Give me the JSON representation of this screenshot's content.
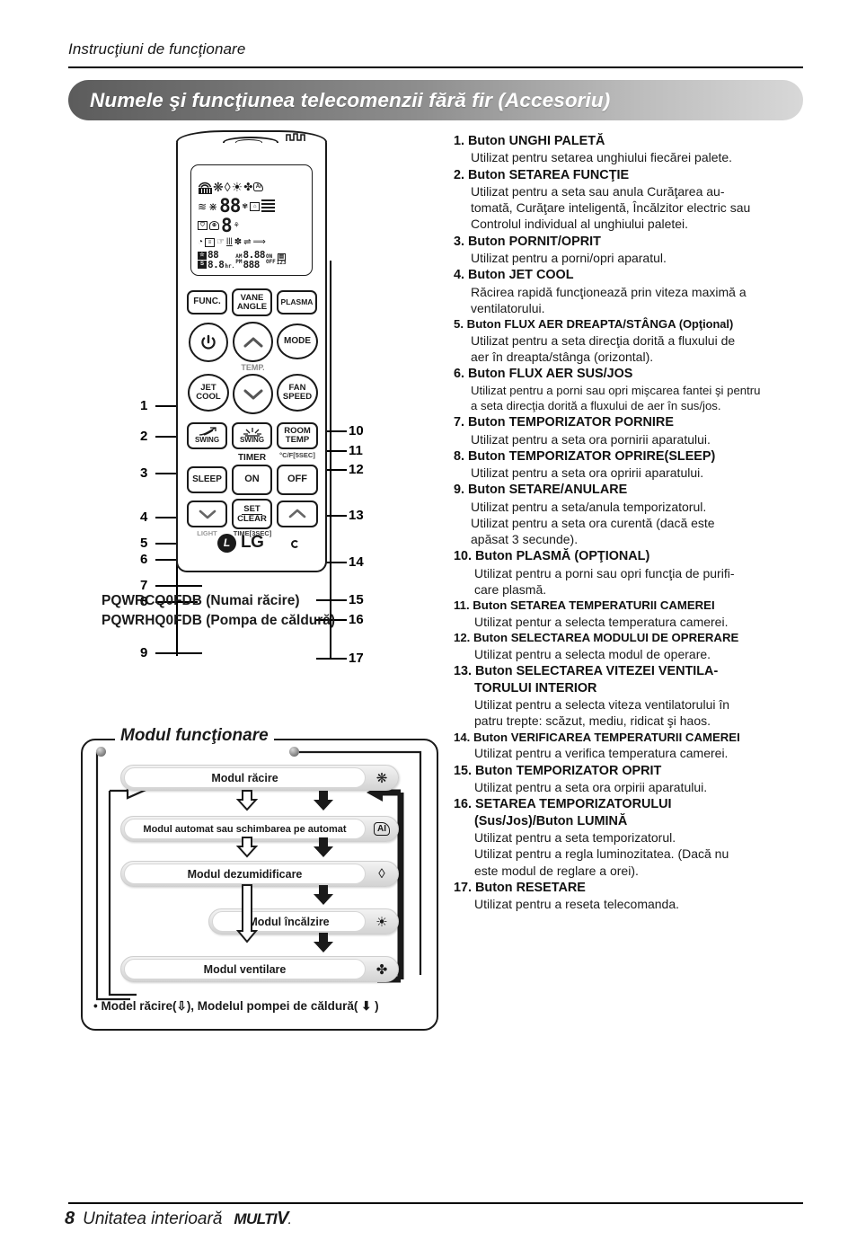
{
  "header": {
    "kicker": "Instrucţiuni de funcţionare",
    "title": "Numele şi funcţiunea telecomenzii fără fir (Accesoriu)"
  },
  "remote": {
    "callouts_left": [
      "1",
      "2",
      "3",
      "4",
      "5",
      "6",
      "7",
      "8",
      "9"
    ],
    "callouts_right": [
      "10",
      "11",
      "12",
      "13",
      "14",
      "15",
      "16",
      "17"
    ],
    "buttons": [
      {
        "id": "func",
        "label": "FUNC."
      },
      {
        "id": "vane-angle",
        "label": "VANE\nANGLE"
      },
      {
        "id": "plasma",
        "label": "PLASMA"
      },
      {
        "id": "power",
        "label": ""
      },
      {
        "id": "temp-up",
        "label": ""
      },
      {
        "id": "mode",
        "label": "MODE"
      },
      {
        "id": "jet-cool",
        "label": "JET\nCOOL"
      },
      {
        "id": "temp-down",
        "label": ""
      },
      {
        "id": "fan-speed",
        "label": "FAN\nSPEED"
      },
      {
        "id": "swing-lr",
        "label": "SWING"
      },
      {
        "id": "swing-ud",
        "label": "SWING"
      },
      {
        "id": "room-temp",
        "label": "ROOM\nTEMP"
      },
      {
        "id": "sleep",
        "label": "SLEEP"
      },
      {
        "id": "timer-on",
        "label": "ON"
      },
      {
        "id": "timer-off",
        "label": "OFF"
      },
      {
        "id": "light-down",
        "label": ""
      },
      {
        "id": "set-clear",
        "label": "SET\nCLEAR"
      },
      {
        "id": "timer-up",
        "label": ""
      }
    ],
    "sublabels": {
      "temp": "TEMP.",
      "timer": "TIMER",
      "room_temp_unit": "°C/F[5SEC]",
      "light": "LIGHT",
      "time_sec": "TIME[3SEC]"
    },
    "lcd": {
      "row1_icons": "signal-icon, snowflake-icon, droplet-icon, sun-icon, fan-icon, ai-icon",
      "row2_digits": "88",
      "row3_digits": "8",
      "clock_am": "AM",
      "clock_pm": "PM",
      "clock_hr": "hr.",
      "clock_on": "ON",
      "clock_off": "OFF",
      "clock_123": "123",
      "timer_star": "☆",
      "timer_s": "S",
      "timer_digits": "88",
      "timer_digits2": "8.8",
      "clock_digits1": "8.88",
      "clock_digits2": "888"
    },
    "brand": "LG",
    "brand_mark": "L"
  },
  "models": {
    "line1": "PQWRCQ0FDB (Numai răcire)",
    "line2": "PQWRHQ0FDB (Pompa de căldură)"
  },
  "flow": {
    "title": "Modul funcţionare",
    "steps": [
      {
        "label": "Modul răcire",
        "icon": "❋"
      },
      {
        "label": "Modul automat sau schimbarea pe automat",
        "icon": "AI"
      },
      {
        "label": "Modul dezumidificare",
        "icon": "◊"
      },
      {
        "label": "Modul încălzire",
        "icon": "☀"
      },
      {
        "label": "Modul ventilare",
        "icon": "✤"
      }
    ],
    "note": "• Model răcire(⇩), Modelul pompei de căldură( ⬇ )"
  },
  "instructions": [
    {
      "num": "1.",
      "title": "Buton UNGHI PALETĂ",
      "lines": [
        "Utilizat pentru setarea unghiului fiecărei palete."
      ]
    },
    {
      "num": "2.",
      "title": "Buton SETAREA FUNCŢIE",
      "lines": [
        "Utilizat pentru a seta sau anula Curăţarea au-",
        "tomată, Curăţare inteligentă, Încălzitor electric sau",
        "Controlul individual al unghiului paletei."
      ]
    },
    {
      "num": "3.",
      "title": "Buton PORNIT/OPRIT",
      "lines": [
        "Utilizat pentru a porni/opri aparatul."
      ]
    },
    {
      "num": "4.",
      "title": "Buton JET COOL",
      "lines": [
        "Răcirea rapidă funcţionează prin viteza maximă a",
        "ventilatorului."
      ]
    },
    {
      "num": "5.",
      "title": "Buton FLUX AER DREAPTA/STÂNGA",
      "suffix": "(Opţional)",
      "small": true,
      "lines": [
        "Utilizat pentru a seta direcţia dorită a fluxului de",
        "aer în dreapta/stânga (orizontal)."
      ]
    },
    {
      "num": "6.",
      "title": "Buton FLUX AER SUS/JOS",
      "smallBody": true,
      "lines": [
        "Utilizat pentru a porni sau opri mişcarea fantei şi pentru",
        "a seta direcţia dorită a fluxului de aer în sus/jos."
      ]
    },
    {
      "num": "7.",
      "title": "Buton TEMPORIZATOR PORNIRE",
      "lines": [
        "Utilizat pentru a seta ora pornirii aparatului."
      ]
    },
    {
      "num": "8.",
      "title": "Buton TEMPORIZATOR OPRIRE(SLEEP)",
      "lines": [
        "Utilizat pentru a seta ora opririi aparatului."
      ]
    },
    {
      "num": "9.",
      "title": "Buton SETARE/ANULARE",
      "lines": [
        "Utilizat pentru a seta/anula temporizatorul.",
        "Utilizat pentru a seta ora curentă (dacă este",
        "apăsat 3 secunde)."
      ]
    },
    {
      "num": "10.",
      "title": "Buton PLASMĂ (OPŢIONAL)",
      "indent": true,
      "lines": [
        "Utilizat pentru a porni sau opri funcţia de purifi-",
        "care plasmă."
      ]
    },
    {
      "num": "11.",
      "title": "Buton SETAREA TEMPERATURII CAMEREI",
      "smallTitle": true,
      "indent": true,
      "lines": [
        "Utilizat pentur a selecta temperatura camerei."
      ]
    },
    {
      "num": "12.",
      "title": "Buton SELECTAREA MODULUI DE OPRERARE",
      "smallTitle": true,
      "indent": true,
      "lines": [
        "Utilizat pentru a selecta modul de operare."
      ]
    },
    {
      "num": "13.",
      "title": "Buton SELECTAREA VITEZEI VENTILA-",
      "title2": "TORULUI INTERIOR",
      "indent": true,
      "lines": [
        "Utilizat pentru a selecta viteza ventilatorului în",
        "patru trepte: scăzut, mediu, ridicat şi haos."
      ]
    },
    {
      "num": "14.",
      "title": "Buton VERIFICAREA TEMPERATURII CAMEREI",
      "smallTitle": true,
      "indent": true,
      "lines": [
        "Utilizat pentru a verifica temperatura camerei."
      ]
    },
    {
      "num": "15.",
      "title": "Buton TEMPORIZATOR OPRIT",
      "indent": true,
      "lines": [
        "Utilizat pentru a seta ora orpirii aparatului."
      ]
    },
    {
      "num": "16.",
      "title": "SETAREA TEMPORIZATORULUI",
      "title2": "(Sus/Jos)/Buton LUMINĂ",
      "indent": true,
      "lines": [
        "Utilizat pentru a seta temporizatorul.",
        "Utilizat pentru a regla luminozitatea. (Dacă nu",
        "este modul de reglare a orei)."
      ]
    },
    {
      "num": "17.",
      "title": "Buton RESETARE",
      "indent": true,
      "lines": [
        "Utilizat pentru a reseta telecomanda."
      ]
    }
  ],
  "footer": {
    "page": "8",
    "label": "Unitatea interioară",
    "brand": "MULTI",
    "brand_v": "V",
    "brand_dot": "."
  }
}
